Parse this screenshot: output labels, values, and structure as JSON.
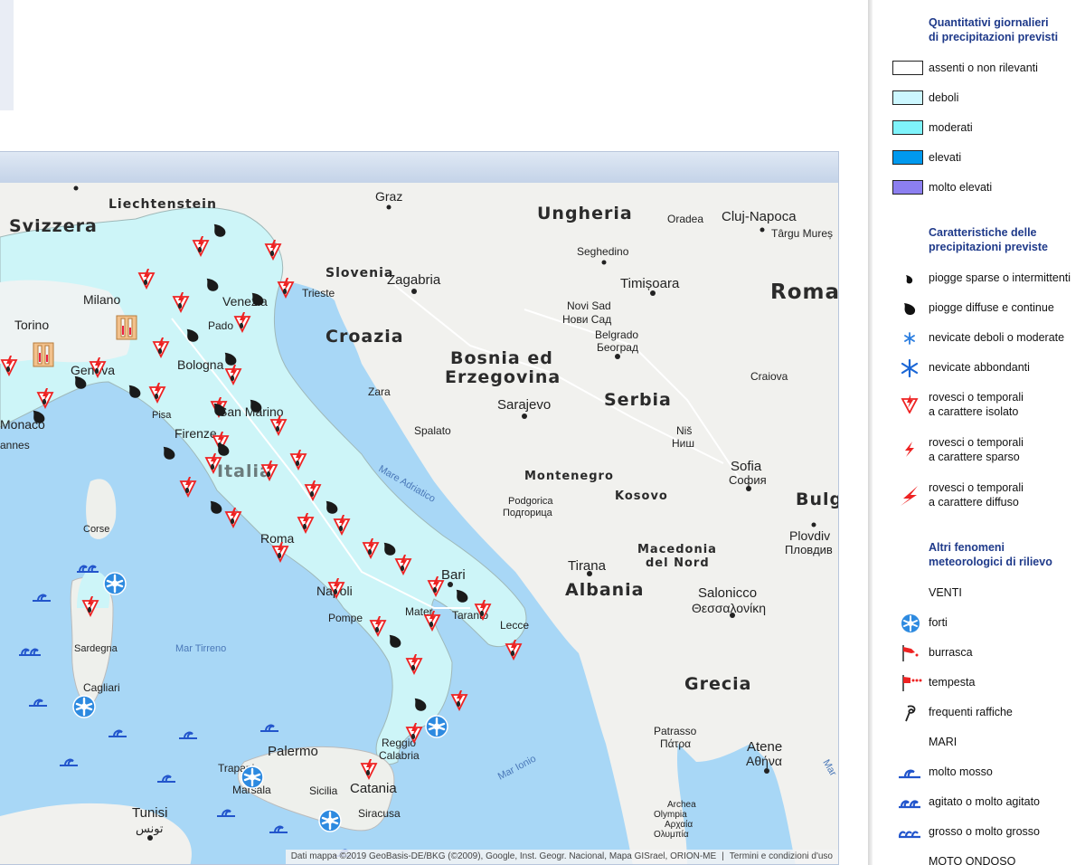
{
  "map": {
    "attribution": "Dati mappa ©2019 GeoBasis-DE/BKG (©2009), Google, Inst. Geogr. Nacional, Mapa GISrael, ORION-ME",
    "terms": "Termini e condizioni d'uso",
    "countries": {
      "svizzera": "Svizzera",
      "liechtenstein": "Liechtenstein",
      "ungheria": "Ungheria",
      "roma_ro": "Roma",
      "slovenia": "Slovenia",
      "croazia": "Croazia",
      "bosnia1": "Bosnia ed",
      "bosnia2": "Erzegovina",
      "serbia": "Serbia",
      "montenegro": "Montenegro",
      "kosovo": "Kosovo",
      "bulg": "Bulg",
      "albania": "Albania",
      "macedonia1": "Macedonia",
      "macedonia2": "del Nord",
      "grecia": "Grecia",
      "italia": "Italia"
    },
    "cities": {
      "graz": "Graz",
      "oradea": "Oradea",
      "cluj": "Cluj-Napoca",
      "targu": "Târgu Mureș",
      "seghedino": "Seghedino",
      "zagabria": "Zagabria",
      "timisoara": "Timișoara",
      "novisad1": "Novi Sad",
      "novisad2": "Нови Сад",
      "belgrado1": "Belgrado",
      "belgrado2": "Београд",
      "craiova": "Craiova",
      "zara": "Zara",
      "sarajevo": "Sarajevo",
      "nis1": "Niš",
      "nis2": "Ниш",
      "spalato": "Spalato",
      "sofia1": "Sofia",
      "sofia2": "София",
      "podgorica1": "Podgorica",
      "podgorica2": "Подгорица",
      "plovdiv1": "Plovdiv",
      "plovdiv2": "Пловдив",
      "tirana": "Tirana",
      "salonicco1": "Salonicco",
      "salonicco2": "Θεσσαλονίκη",
      "patrasso1": "Patrasso",
      "patrasso2": "Πάτρα",
      "atene1": "Atene",
      "atene2": "Αθήνα",
      "archea1": "Archea",
      "archea2": "Olympia",
      "archea3": "Αρχαία",
      "archea4": "Ολυμπία",
      "milano": "Milano",
      "torino": "Torino",
      "venezia": "Venezia",
      "trieste": "Trieste",
      "padova": "Pado",
      "bologna": "Bologna",
      "genova": "Genova",
      "monaco": "Monaco",
      "cannes": "annes",
      "firenze": "Firenze",
      "pisa": "Pisa",
      "sanmarino": "San Marino",
      "roma": "Roma",
      "napoli": "Napoli",
      "pompei": "Pompe",
      "bari": "Bari",
      "taranto": "Taranto",
      "matera": "Mater",
      "lecce": "Lecce",
      "corse": "Corse",
      "sardegna": "Sardegna",
      "cagliari": "Cagliari",
      "palermo": "Palermo",
      "trapani": "Trapani",
      "marsala": "Marsala",
      "sicilia": "Sicilia",
      "catania": "Catania",
      "siracusa": "Siracusa",
      "reggio1": "Reggio",
      "reggio2": "Calabria",
      "tunisi1": "Tunisi",
      "tunisi2": "تونس"
    },
    "seas": {
      "adriatico": "Mare Adriatico",
      "tirreno": "Mar Tirreno",
      "ionio": "Mar Ionio",
      "mar_right": "Mar"
    }
  },
  "legend": {
    "section1": {
      "title1": "Quantitativi giornalieri",
      "title2": "di precipitazioni previsti"
    },
    "quantities": [
      {
        "label": "assenti o non rilevanti",
        "color": "#ffffff"
      },
      {
        "label": "deboli",
        "color": "#ccf7ff"
      },
      {
        "label": "moderati",
        "color": "#7ff3fb"
      },
      {
        "label": "elevati",
        "color": "#0099ee"
      },
      {
        "label": "molto elevati",
        "color": "#8c7ff0"
      }
    ],
    "section2": {
      "title1": "Caratteristiche delle",
      "title2": "precipitazioni previste"
    },
    "characteristics": [
      {
        "label": "piogge sparse o intermittenti",
        "icon": "small-raindrop-icon"
      },
      {
        "label": "piogge diffuse e continue",
        "icon": "large-raindrop-icon"
      },
      {
        "label": "nevicate deboli o moderate",
        "icon": "small-snowflake-icon"
      },
      {
        "label": "nevicate abbondanti",
        "icon": "large-snowflake-icon"
      },
      {
        "label1": "rovesci o temporali",
        "label2": "a carattere isolato",
        "icon": "isolated-thunderstorm-icon"
      },
      {
        "label1": "rovesci o temporali",
        "label2": "a carattere sparso",
        "icon": "scattered-thunderstorm-icon"
      },
      {
        "label1": "rovesci o temporali",
        "label2": "a carattere diffuso",
        "icon": "widespread-thunderstorm-icon"
      }
    ],
    "section3": {
      "title1": "Altri fenomeni",
      "title2": "meteorologici di rilievo"
    },
    "venti_title": "VENTI",
    "venti": [
      {
        "label": "forti",
        "icon": "strong-wind-icon"
      },
      {
        "label": "burrasca",
        "icon": "gale-windsock-icon"
      },
      {
        "label": "tempesta",
        "icon": "storm-windsock-icon"
      },
      {
        "label": "frequenti raffiche",
        "icon": "gusts-icon"
      }
    ],
    "mari_title": "MARI",
    "mari": [
      {
        "label": "molto mosso",
        "icon": "rough-sea-icon"
      },
      {
        "label": "agitato o molto agitato",
        "icon": "very-rough-sea-icon"
      },
      {
        "label": "grosso o molto grosso",
        "icon": "high-sea-icon"
      }
    ],
    "moto_title": "MOTO ONDOSO"
  }
}
